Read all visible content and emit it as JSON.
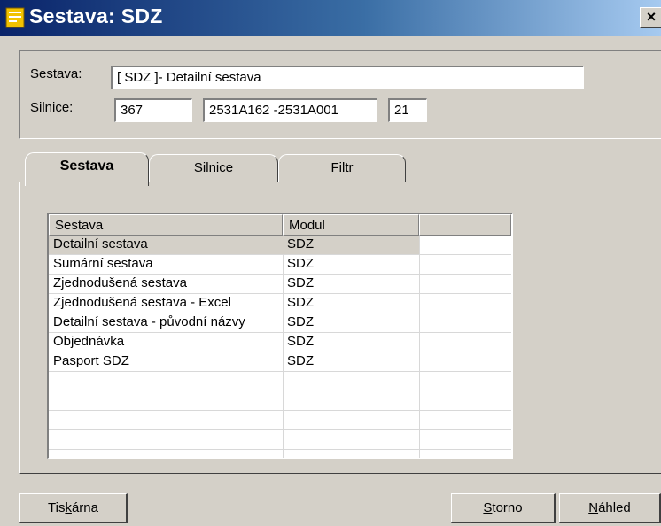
{
  "window": {
    "title": "Sestava: SDZ",
    "close_glyph": "×",
    "icon": "report-icon"
  },
  "form": {
    "sestava_label": "Sestava:",
    "sestava_value": "[ SDZ ]- Detailní sestava",
    "silnice_label": "Silnice:",
    "silnice_value1": "367",
    "silnice_value2": "2531A162  -2531A001",
    "silnice_value3": "21"
  },
  "tabs": [
    {
      "label": "Sestava",
      "active": true
    },
    {
      "label": "Silnice",
      "active": false
    },
    {
      "label": "Filtr",
      "active": false
    }
  ],
  "table": {
    "columns": [
      "Sestava",
      "Modul",
      ""
    ],
    "rows": [
      {
        "sestava": "Detailní sestava",
        "modul": "SDZ",
        "selected": true
      },
      {
        "sestava": "Sumární sestava",
        "modul": "SDZ"
      },
      {
        "sestava": "Zjednodušená sestava",
        "modul": "SDZ"
      },
      {
        "sestava": "Zjednodušená sestava - Excel",
        "modul": "SDZ"
      },
      {
        "sestava": "Detailní sestava - původní názvy",
        "modul": "SDZ"
      },
      {
        "sestava": "Objednávka",
        "modul": "SDZ"
      },
      {
        "sestava": "Pasport SDZ",
        "modul": "SDZ"
      },
      {
        "sestava": "",
        "modul": ""
      },
      {
        "sestava": "",
        "modul": ""
      },
      {
        "sestava": "",
        "modul": ""
      },
      {
        "sestava": "",
        "modul": ""
      }
    ]
  },
  "buttons": {
    "tiskarna_pre": "Tis",
    "tiskarna_key": "k",
    "tiskarna_post": "árna",
    "storno_key": "S",
    "storno_post": "torno",
    "nahled_key": "N",
    "nahled_post": "áhled"
  },
  "colors": {
    "title_start": "#0a246a",
    "title_end": "#a6caf0",
    "face": "#d4d0c8"
  }
}
